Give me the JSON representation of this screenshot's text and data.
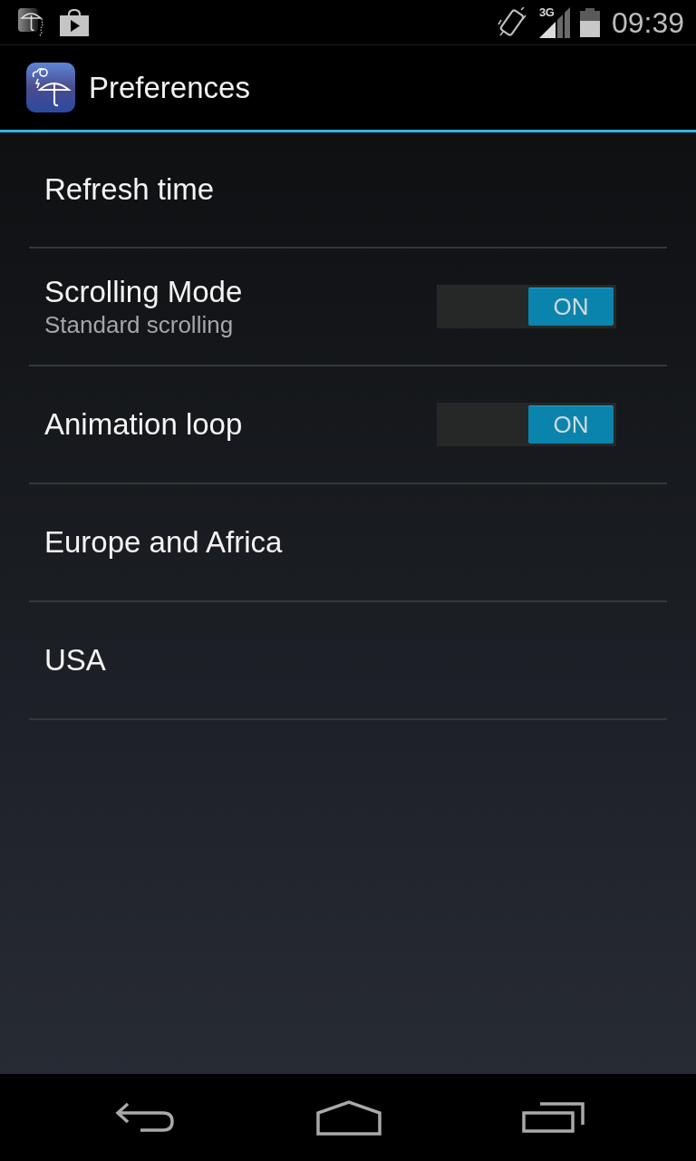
{
  "status_bar": {
    "network_type": "3G",
    "time": "09:39"
  },
  "action_bar": {
    "title": "Preferences"
  },
  "preferences": [
    {
      "kind": "plain",
      "title": "Refresh time"
    },
    {
      "kind": "switch",
      "title": "Scrolling Mode",
      "summary": "Standard scrolling",
      "on": true,
      "switch_label": "ON"
    },
    {
      "kind": "switch",
      "title": "Animation loop",
      "on": true,
      "switch_label": "ON"
    },
    {
      "kind": "plain",
      "title": "Europe and Africa"
    },
    {
      "kind": "plain",
      "title": "USA"
    }
  ]
}
